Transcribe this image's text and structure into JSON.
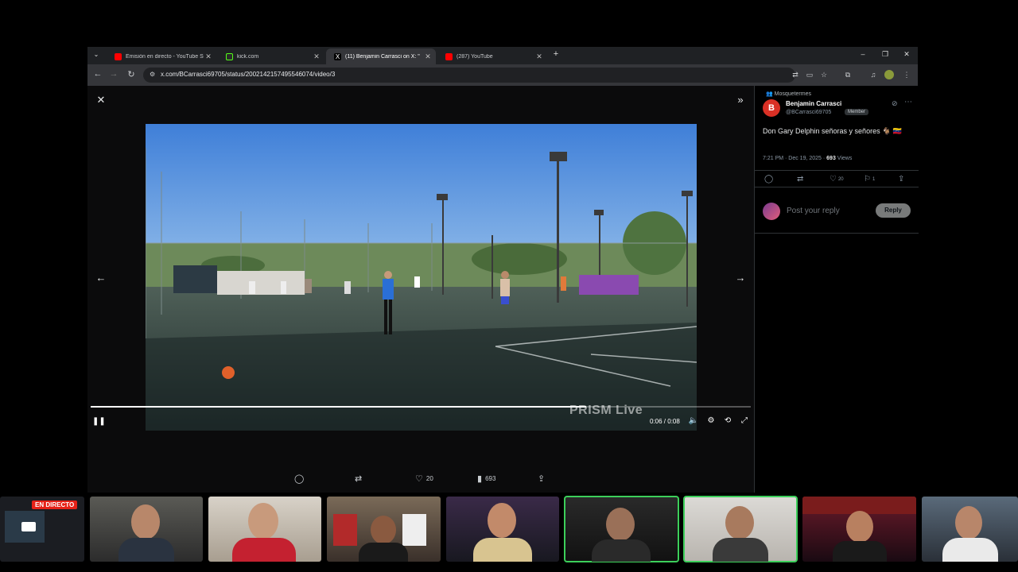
{
  "browser": {
    "tabs": [
      {
        "label": "Emisión en directo - YouTube Stu",
        "favicon_color": "#ff0000",
        "active": false
      },
      {
        "label": "kick.com",
        "favicon_color": "#53fc18",
        "active": false
      },
      {
        "label": "(11) Benjamin Carrasci on X: \"",
        "favicon_color": "#ffffff",
        "active": true
      },
      {
        "label": "(287) YouTube",
        "favicon_color": "#ff0000",
        "active": false
      }
    ],
    "new_tab": "+",
    "url": "x.com/BCarrasci69705/status/2002142157495546074/video/3",
    "window_controls": {
      "minimize": "–",
      "restore": "❐",
      "close": "✕"
    }
  },
  "media": {
    "close_icon": "✕",
    "expand_icon": "»",
    "prev_icon": "←",
    "next_icon": "→",
    "progress_fraction": 0.75,
    "time": "0:06 / 0:08",
    "watermark": "PRISM Live",
    "play_state_icon": "❚❚",
    "actions": {
      "likes": "20",
      "views": "693"
    }
  },
  "tweet": {
    "community": "Mosquetermes",
    "avatar_letter": "B",
    "author_name": "Benjamin Carrasci",
    "handle": "@BCarrasci69705",
    "member_badge": "Member",
    "text": "Don Gary Delphin señoras y señores 🐐 🇻🇪",
    "time": "7:21 PM · Dec 19, 2025 · ",
    "views_count": "693",
    "views_label": " Views",
    "likes": "20",
    "bookmarks": "1",
    "reply_placeholder": "Post your reply",
    "reply_button": "Reply"
  },
  "stream": {
    "live_badge": "EN DIRECTO"
  },
  "colors": {
    "accent_live": "#e62117",
    "speaking_outline": "#3ccf5a"
  }
}
